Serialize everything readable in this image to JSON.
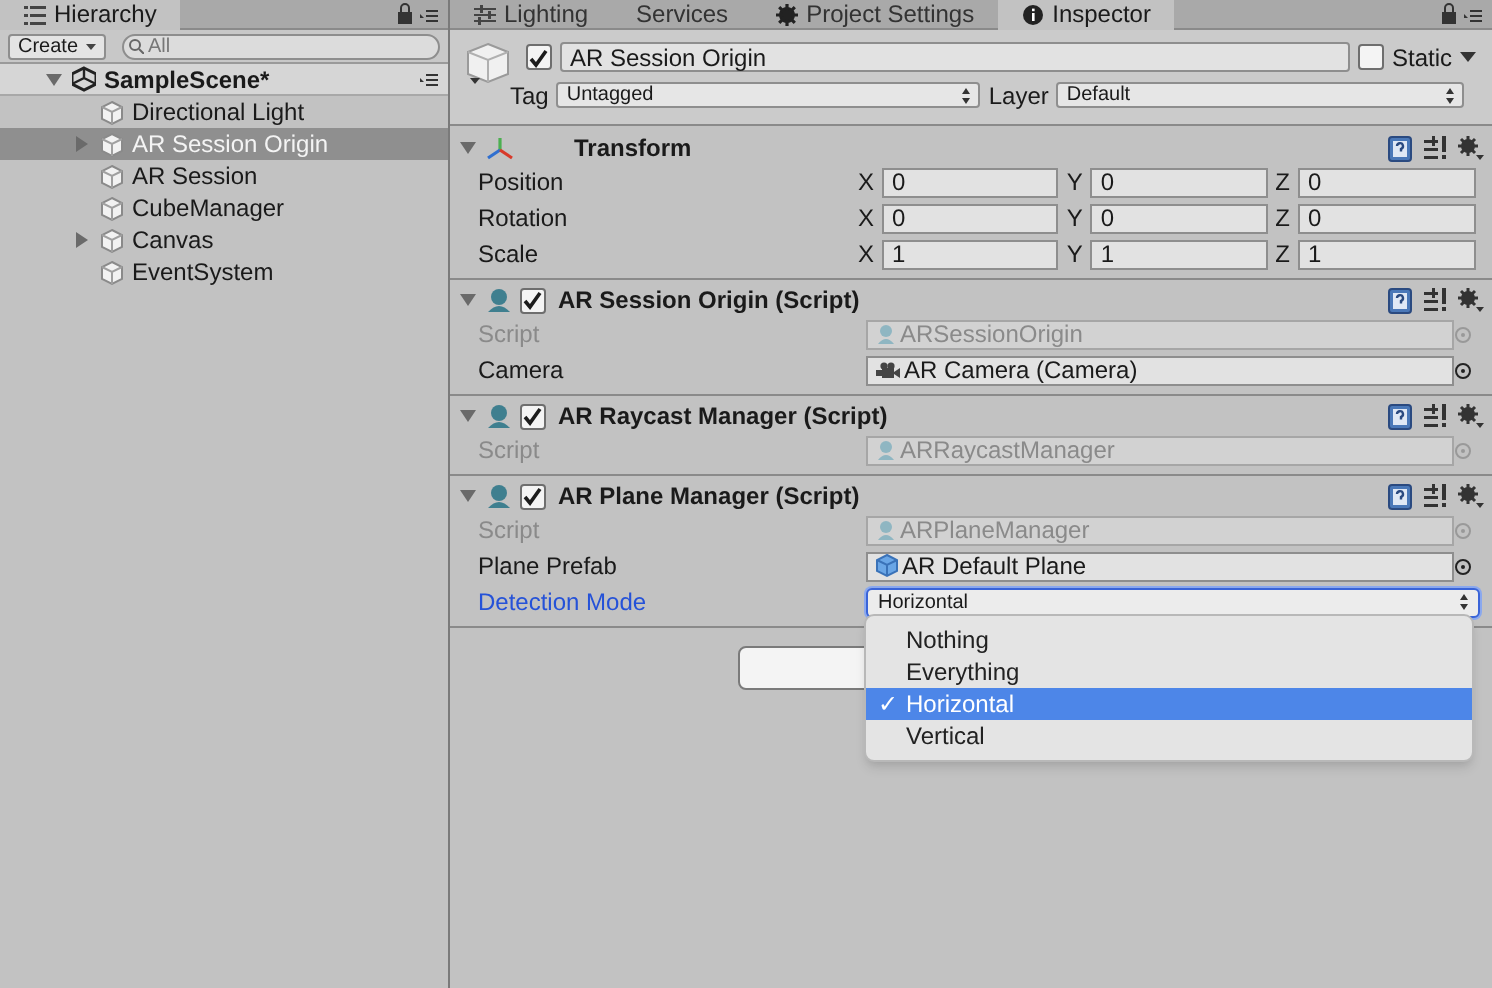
{
  "hierarchy": {
    "tab": "Hierarchy",
    "create": "Create",
    "search": {
      "placeholder": "All"
    },
    "scene": {
      "name": "SampleScene*",
      "expanded": true
    },
    "items": [
      {
        "label": "Directional Light",
        "has_children": false,
        "selected": false
      },
      {
        "label": "AR Session Origin",
        "has_children": true,
        "selected": true
      },
      {
        "label": "AR Session",
        "has_children": false,
        "selected": false
      },
      {
        "label": "CubeManager",
        "has_children": false,
        "selected": false
      },
      {
        "label": "Canvas",
        "has_children": true,
        "selected": false
      },
      {
        "label": "EventSystem",
        "has_children": false,
        "selected": false
      }
    ]
  },
  "tabs": [
    {
      "label": "Lighting",
      "selected": false
    },
    {
      "label": "Services",
      "selected": false
    },
    {
      "label": "Project Settings",
      "selected": false
    },
    {
      "label": "Inspector",
      "selected": true
    }
  ],
  "object": {
    "active": true,
    "name": "AR Session Origin",
    "static_label": "Static",
    "static": false,
    "tag_label": "Tag",
    "tag": "Untagged",
    "layer_label": "Layer",
    "layer": "Default"
  },
  "components": [
    {
      "title": "Transform",
      "kind": "transform",
      "expanded": true,
      "rows": [
        {
          "label": "Position",
          "values": [
            {
              "axis": "X",
              "value": "0"
            },
            {
              "axis": "Y",
              "value": "0"
            },
            {
              "axis": "Z",
              "value": "0"
            }
          ]
        },
        {
          "label": "Rotation",
          "values": [
            {
              "axis": "X",
              "value": "0"
            },
            {
              "axis": "Y",
              "value": "0"
            },
            {
              "axis": "Z",
              "value": "0"
            }
          ]
        },
        {
          "label": "Scale",
          "values": [
            {
              "axis": "X",
              "value": "1"
            },
            {
              "axis": "Y",
              "value": "1"
            },
            {
              "axis": "Z",
              "value": "1"
            }
          ]
        }
      ]
    },
    {
      "title": "AR Session Origin (Script)",
      "kind": "script",
      "expanded": true,
      "enabled": true,
      "fields": [
        {
          "label": "Script",
          "kind": "script",
          "value": "ARSessionOrigin"
        },
        {
          "label": "Camera",
          "kind": "camera",
          "value": "AR Camera (Camera)"
        }
      ]
    },
    {
      "title": "AR Raycast Manager (Script)",
      "kind": "script",
      "expanded": true,
      "enabled": true,
      "fields": [
        {
          "label": "Script",
          "kind": "script",
          "value": "ARRaycastManager"
        }
      ]
    },
    {
      "title": "AR Plane Manager (Script)",
      "kind": "script",
      "expanded": true,
      "enabled": true,
      "fields": [
        {
          "label": "Script",
          "kind": "script",
          "value": "ARPlaneManager"
        },
        {
          "label": "Plane Prefab",
          "kind": "prefab",
          "value": "AR Default Plane"
        },
        {
          "label": "Detection Mode",
          "kind": "enum",
          "value": "Horizontal",
          "focused": true
        }
      ]
    }
  ],
  "dropdown": {
    "options": [
      {
        "label": "Nothing",
        "selected": false
      },
      {
        "label": "Everything",
        "selected": false
      },
      {
        "label": "Horizontal",
        "selected": true,
        "mark": "✓"
      },
      {
        "label": "Vertical",
        "selected": false
      }
    ]
  }
}
